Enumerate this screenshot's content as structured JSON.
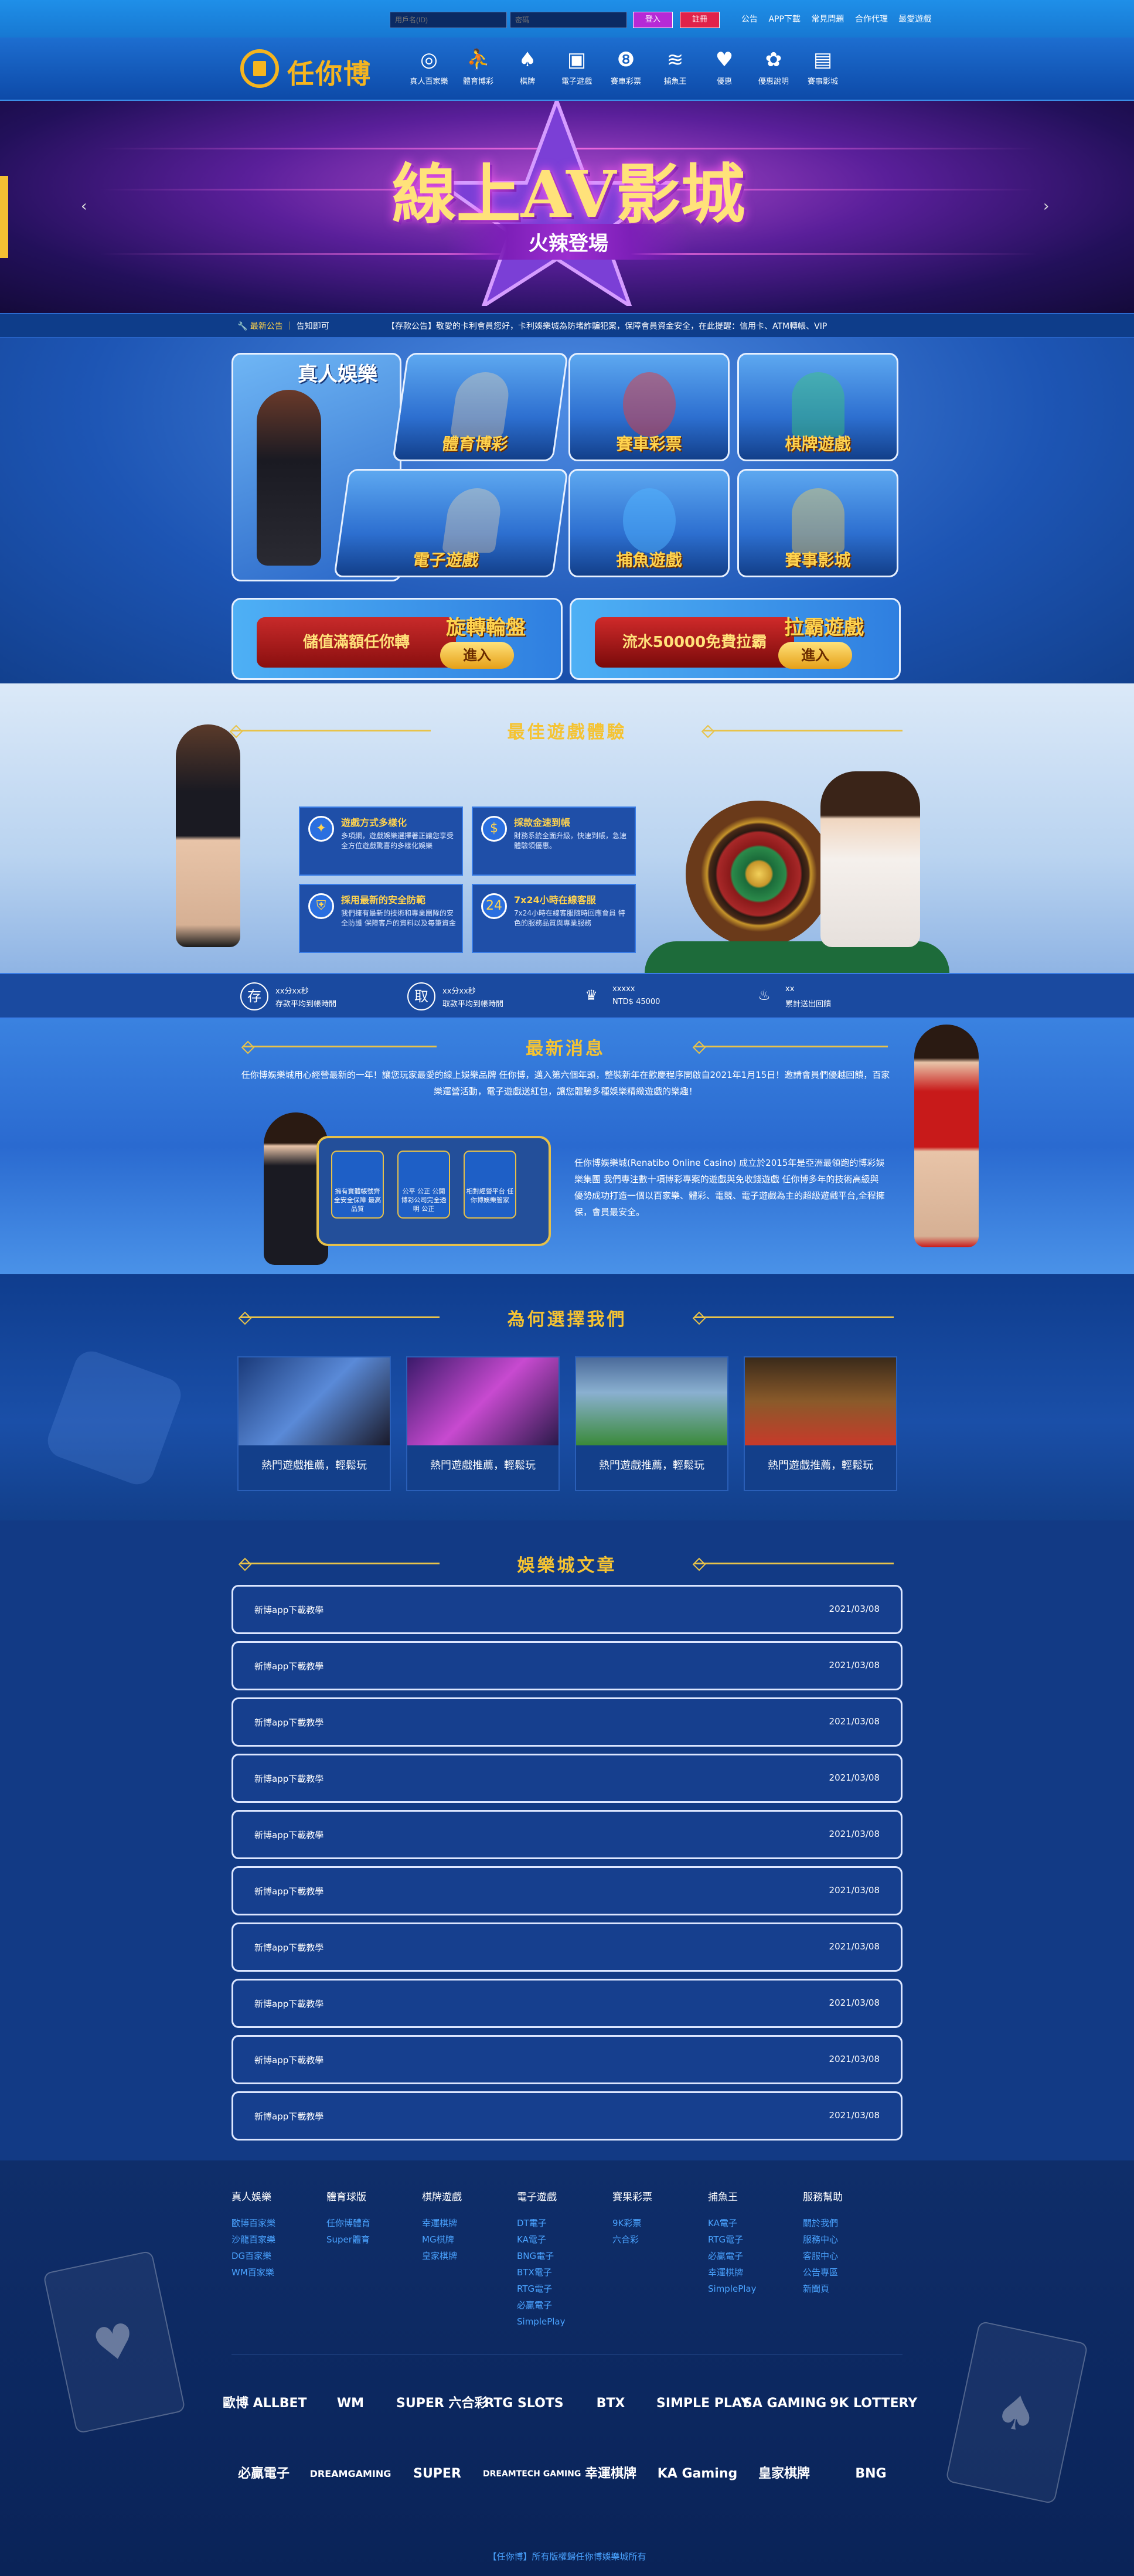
{
  "topbar": {
    "username_placeholder": "用戶名(ID)",
    "password_placeholder": "密碼",
    "login_label": "登入",
    "register_label": "註冊",
    "links": [
      "公告",
      "APP下載",
      "常見問題",
      "合作代理",
      "最愛遊戲"
    ]
  },
  "brand": {
    "name": "任你博"
  },
  "nav": {
    "items": [
      {
        "label": "真人百家樂",
        "icon": "dice-icon"
      },
      {
        "label": "體育博彩",
        "icon": "runner-icon"
      },
      {
        "label": "棋牌",
        "icon": "card-icon"
      },
      {
        "label": "電子遊戲",
        "icon": "slot-icon"
      },
      {
        "label": "賽車彩票",
        "icon": "lottery-icon"
      },
      {
        "label": "捕魚王",
        "icon": "fish-icon"
      },
      {
        "label": "優惠",
        "icon": "heart-icon"
      },
      {
        "label": "優惠說明",
        "icon": "gift-icon"
      },
      {
        "label": "賽事影城",
        "icon": "video-icon"
      }
    ]
  },
  "banner": {
    "title": "線上AV影城",
    "subtitle": "火辣登場"
  },
  "notice": {
    "label": "最新公告",
    "sub": "告知即可",
    "text": "【存款公告】敬愛的卡利會員您好，卡利娛樂城為防堵詐騙犯案，保障會員資金安全，在此提醒：信用卡、ATM轉帳、VIP"
  },
  "games": {
    "tiles": [
      "真人娛樂",
      "體育博彩",
      "賽車彩票",
      "棋牌遊戲",
      "電子遊戲",
      "捕魚遊戲",
      "賽事影城"
    ],
    "promos": [
      {
        "title": "旋轉輪盤",
        "promo": "儲值滿額任你轉",
        "enter": "進入"
      },
      {
        "title": "拉霸遊戲",
        "promo": "流水50000免費拉霸",
        "enter": "進入"
      }
    ]
  },
  "feature": {
    "title": "最佳遊戲體驗",
    "boxes": [
      {
        "title": "遊戲方式多樣化",
        "desc": "多項網，遊戲娛樂選擇著正讓您享受全方位遊戲驚喜的多樣化娛樂",
        "icon": "gamepad-icon"
      },
      {
        "title": "採款金速到帳",
        "desc": "財務系統全面升級，快速到帳，急速體驗領優惠。",
        "icon": "coin-icon"
      },
      {
        "title": "採用最新的安全防範",
        "desc": "我們擁有最新的技術和專業團隊的安全防護 保障客戶的資料以及每筆資金",
        "icon": "shield-icon"
      },
      {
        "title": "7x24小時在線客服",
        "desc": "7x24小時在線客服隨時回應會員 特色的服務品質與專業服務",
        "icon": "clock-icon"
      }
    ]
  },
  "stats": [
    {
      "value": "xx分xx秒",
      "label": "存款平均到帳時間",
      "icon": "deposit-icon"
    },
    {
      "value": "xx分xx秒",
      "label": "取款平均到帳時間",
      "icon": "withdraw-icon"
    },
    {
      "value": "xxxxx",
      "label": "NTD$ 45000",
      "icon": "trophy-icon"
    },
    {
      "value": "xx",
      "label": "累計送出回饋",
      "icon": "piggy-icon"
    }
  ],
  "news": {
    "title": "最新消息",
    "intro": "任你博娛樂城用心經營最新的一年！讓您玩家最愛的線上娛樂品牌 任你博，邁入第六個年頭，整裝新年在歡慶程序開啟自2021年1月15日！邀請會員們優越回饋，百家樂運營活動，電子遊戲送紅包，讓您體驗多種娛樂精緻遊戲的樂趣！",
    "shields": [
      "擁有實體帳號齊全安全保障 最高品質",
      "公平 公正 公開 博彩公司完全透明 公正",
      "相對經營平台 任你博娛樂管家"
    ],
    "about": "任你博娛樂城(Renatibo Online Casino) 成立於2015年是亞洲最領跑的博彩娛樂集團 我們專注數十項博彩專案的遊戲與免收錢遊戲 任你博多年的技術高級與優勢成功打造一個以百家樂、體彩、電競、電子遊戲為主的超級遊戲平台,全程擁保，會員最安全。"
  },
  "why": {
    "title": "為何選擇我們",
    "cards": [
      "熱門遊戲推薦，輕鬆玩",
      "熱門遊戲推薦，輕鬆玩",
      "熱門遊戲推薦，輕鬆玩",
      "熱門遊戲推薦，輕鬆玩"
    ]
  },
  "articles": {
    "title": "娛樂城文章",
    "items": [
      {
        "title": "新博app下載教學",
        "date": "2021/03/08"
      },
      {
        "title": "新博app下載教學",
        "date": "2021/03/08"
      },
      {
        "title": "新博app下載教學",
        "date": "2021/03/08"
      },
      {
        "title": "新博app下載教學",
        "date": "2021/03/08"
      },
      {
        "title": "新博app下載教學",
        "date": "2021/03/08"
      },
      {
        "title": "新博app下載教學",
        "date": "2021/03/08"
      },
      {
        "title": "新博app下載教學",
        "date": "2021/03/08"
      },
      {
        "title": "新博app下載教學",
        "date": "2021/03/08"
      },
      {
        "title": "新博app下載教學",
        "date": "2021/03/08"
      },
      {
        "title": "新博app下載教學",
        "date": "2021/03/08"
      }
    ]
  },
  "footer": {
    "columns": [
      {
        "title": "真人娛樂",
        "items": [
          "歐博百家樂",
          "沙龍百家樂",
          "DG百家樂",
          "WM百家樂"
        ]
      },
      {
        "title": "體育球版",
        "items": [
          "任你博體育",
          "Super體育"
        ]
      },
      {
        "title": "棋牌遊戲",
        "items": [
          "幸運棋牌",
          "MG棋牌",
          "皇家棋牌"
        ]
      },
      {
        "title": "電子遊戲",
        "items": [
          "DT電子",
          "KA電子",
          "BNG電子",
          "BTX電子",
          "RTG電子",
          "必贏電子",
          "SimplePlay"
        ]
      },
      {
        "title": "賽果彩票",
        "items": [
          "9K彩票",
          "六合彩"
        ]
      },
      {
        "title": "捕魚王",
        "items": [
          "KA電子",
          "RTG電子",
          "必贏電子",
          "幸運棋牌",
          "SimplePlay"
        ]
      },
      {
        "title": "服務幫助",
        "items": [
          "關於我們",
          "服務中心",
          "客服中心",
          "公告專區",
          "新聞頁"
        ]
      }
    ],
    "brands_row1": [
      "歐博 ALLBET",
      "WM",
      "SUPER 六合彩",
      "RTG SLOTS",
      "BTX",
      "SIMPLE PLAY",
      "SA GAMING",
      "9K LOTTERY"
    ],
    "brands_row2": [
      "必贏電子",
      "DREAMGAMING",
      "SUPER",
      "DREAMTECH GAMING",
      "幸運棋牌",
      "KA Gaming",
      "皇家棋牌",
      "BNG"
    ],
    "copyright": "【任你博】所有版權歸任你博娛樂城所有"
  }
}
